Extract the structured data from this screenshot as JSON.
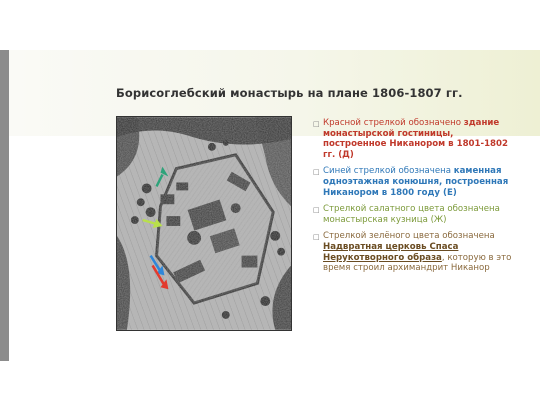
{
  "slide": {
    "title": "Борисоглебский монастырь на плане 1806-1807 гг.",
    "colors": {
      "red": "#c0392b",
      "blue": "#2f78b8",
      "green_light": "#7c9a3a",
      "brown": "#8a6a3e",
      "sidebar": "#8c8c8c",
      "arrow_red": "#e23a2e",
      "arrow_blue": "#2e86d9",
      "arrow_salad": "#b9e04a",
      "arrow_green": "#2ea37a"
    },
    "map": {
      "description_icon": "historic-monastery-plan-image"
    },
    "legend": [
      {
        "lead": "Красной стрелкой обозначено",
        "bold": "здание монастырской гостиницы, построенное Никанором в 1801-1802 гг. (Д)"
      },
      {
        "lead": "Синей стрелкой обозначена",
        "bold": "каменная одноэтажная конюшня, построенная Никанором в 1800 году (Е)"
      },
      {
        "text": "Стрелкой салатного цвета обозначена монастырская кузница (Ж)"
      },
      {
        "lead": "Стрелкой зелёного цвета обозначена",
        "bold": "Надвратная церковь Спаса Нерукотворного образа",
        "mid": ",",
        "tail": " которую в это время строил архимандрит Никанор"
      }
    ]
  }
}
